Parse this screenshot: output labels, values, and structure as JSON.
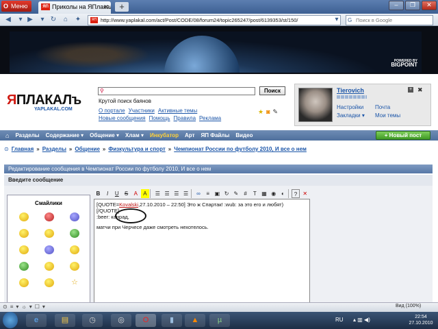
{
  "browser": {
    "menu_label": "Меню",
    "tab_title": "Приколы на ЯПлакал...",
    "url": "http://www.yaplakal.com/act/Post/CODE/08/forum24/topic265247/post/6139353/st/150/",
    "search_placeholder": "Поиск в Google",
    "zoom": "Вид (100%)",
    "window_controls": [
      "–",
      "❐",
      "✕"
    ]
  },
  "banner": {
    "brand_small": "POWERED BY",
    "brand": "BIGPOINT"
  },
  "header": {
    "logo_red": "Я",
    "logo_black": "ПЛАКАЛ",
    "logo_suffix": "ъ",
    "logo_sub": "YAPLAKAL.COM",
    "search_button": "Поиск",
    "search_hint": "Крутой поиск баянов",
    "links_row1": [
      "О портале",
      "Участники",
      "Активные темы"
    ],
    "links_row2": [
      "Новые сообщения",
      "Помощь",
      "Правила",
      "Реклама"
    ]
  },
  "user": {
    "name": "Tierovich",
    "settings": "Настройки",
    "mail": "Почта",
    "bookmarks": "Закладки ▾",
    "my_topics": "Мои темы"
  },
  "nav": {
    "items": [
      "Разделы",
      "Содержание ▾",
      "Общение ▾",
      "Хлам ▾",
      "Инкубатор",
      "Арт",
      "ЯП Файлы",
      "Видео"
    ],
    "highlight_index": 4,
    "new_post": "Новый пост"
  },
  "breadcrumb": [
    "Главная",
    "Разделы",
    "Общение",
    "Физкультура и спорт",
    "Чемпионат России по футболу 2010, И все о нем"
  ],
  "form": {
    "title": "Редактирование сообщения в Чемпионат России по футболу 2010, И все о нем",
    "subtitle": "Введите сообщение",
    "smileys_title": "Смайлики",
    "toolbar": [
      "B",
      "I",
      "U",
      "S",
      "A",
      "A",
      "☰",
      "☰",
      "☰",
      "☰",
      "∞",
      "≡",
      "▣",
      "↻",
      "✎",
      "#",
      "T",
      "▦",
      "◉",
      "◐",
      "?",
      "✕"
    ],
    "editor": {
      "line1_pre": "[QUOTE=",
      "line1_user": "Kovalski",
      "line1_post": ",27.10.2010 – 22:50]",
      "line1_text": " Это ж Спартак! :wub: за это его и любят) [/QUOTE]",
      "line2": ":beer: канрад,",
      "line3": "матчи при Черчесе даже смотреть нехотелось."
    }
  },
  "statusbar": {
    "icons": [
      "⊙",
      "≡",
      "▾",
      "☼",
      "▾",
      "☐",
      "▾"
    ]
  },
  "taskbar": {
    "lang": "RU",
    "time": "22:54",
    "date": "27.10.2010"
  },
  "colors": {
    "accent_blue": "#1b55a8",
    "logo_red": "#d01a12",
    "nav_highlight": "#ffd23a",
    "new_post_green": "#3f9a25"
  }
}
